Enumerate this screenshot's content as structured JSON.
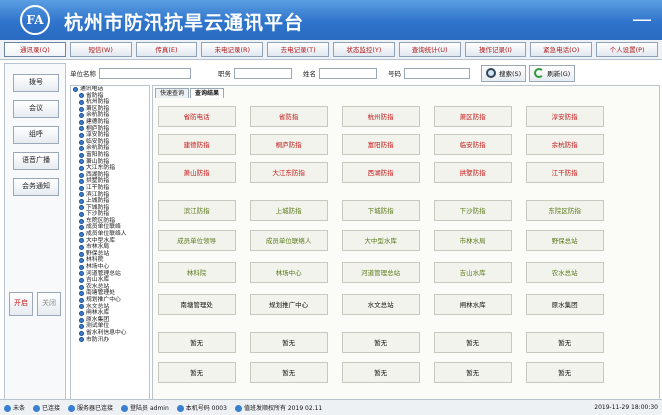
{
  "app": {
    "title": "杭州市防汛抗旱云通讯平台",
    "logo_text": "FA",
    "minimize_label": "—"
  },
  "toolbar": [
    "通讯录(Q)",
    "短信(W)",
    "传真(E)",
    "未电记录(R)",
    "去电记录(T)",
    "状态监控(Y)",
    "查询统计(U)",
    "操作记录(I)",
    "紧急电话(O)",
    "个人设置(P)"
  ],
  "left": {
    "buttons": [
      "拨号",
      "会议",
      "组呼",
      "语音广播",
      "会务通知"
    ],
    "small_buttons": [
      "开启",
      "关闭"
    ]
  },
  "search": {
    "unit_label": "单位名称",
    "position_label": "职务",
    "name_label": "姓名",
    "number_label": "号码",
    "search_button": "搜索(S)",
    "refresh_button": "刷新(G)"
  },
  "tree": {
    "root": "通讯电话",
    "items": [
      "省防指",
      "杭州防指",
      "萧区防指",
      "余杭防指",
      "建德防指",
      "桐庐防指",
      "淳安防指",
      "临安防指",
      "余杭防指",
      "富阳防指",
      "萧山防指",
      "大江东防指",
      "西湖防指",
      "拱墅防指",
      "江干防指",
      "滨江防指",
      "上城防指",
      "下城防指",
      "下沙防指",
      "东院区防指",
      "成员单位联络",
      "成员单位联络人",
      "大中型水库",
      "市林水局",
      "野保总站",
      "林科院",
      "林场中心",
      "河道管理总站",
      "吉山水库",
      "农水总站",
      "南塘管理处",
      "规划推广中心",
      "水文总站",
      "闸林水库",
      "原水集团",
      "测试单位",
      "省水利信息中心",
      "市防汛办"
    ]
  },
  "tabs": [
    "快速查询",
    "查询结果"
  ],
  "grid": [
    [
      "省防电话",
      "省防指",
      "杭州防指",
      "萧区防指",
      "淳安防指"
    ],
    [
      "建德防指",
      "桐庐防指",
      "富阳防指",
      "临安防指",
      "余杭防指"
    ],
    [
      "萧山防指",
      "大江东防指",
      "西湖防指",
      "拱墅防指",
      "江干防指"
    ],
    [
      "滨江防指",
      "上城防指",
      "下城防指",
      "下沙防指",
      "东院区防指"
    ],
    [
      "成员单位领导",
      "成员单位联络人",
      "大中型水库",
      "市林水局",
      "野保总站"
    ],
    [
      "林科院",
      "林场中心",
      "河道管理总站",
      "吉山水库",
      "农水总站"
    ],
    [
      "南塘管理处",
      "规划推广中心",
      "水文总站",
      "闸林水库",
      "原水集团"
    ],
    [
      "暂无",
      "暂无",
      "暂无",
      "暂无",
      "暂无"
    ],
    [
      "暂无",
      "暂无",
      "暂无",
      "暂无",
      "暂无"
    ]
  ],
  "row_colors": [
    "#c41818",
    "#c41818",
    "#c41818",
    "#5a7a1c",
    "#5a7a1c",
    "#5a7a1c",
    "#111111",
    "#111111",
    "#111111"
  ],
  "status": {
    "items": [
      "未条",
      "已连接",
      "服务器已连接",
      "登陆员 admin",
      "本机号码 0003",
      "值班发顺权所有 2019 02.11"
    ],
    "time": "2019-11-29 18:00:30"
  }
}
